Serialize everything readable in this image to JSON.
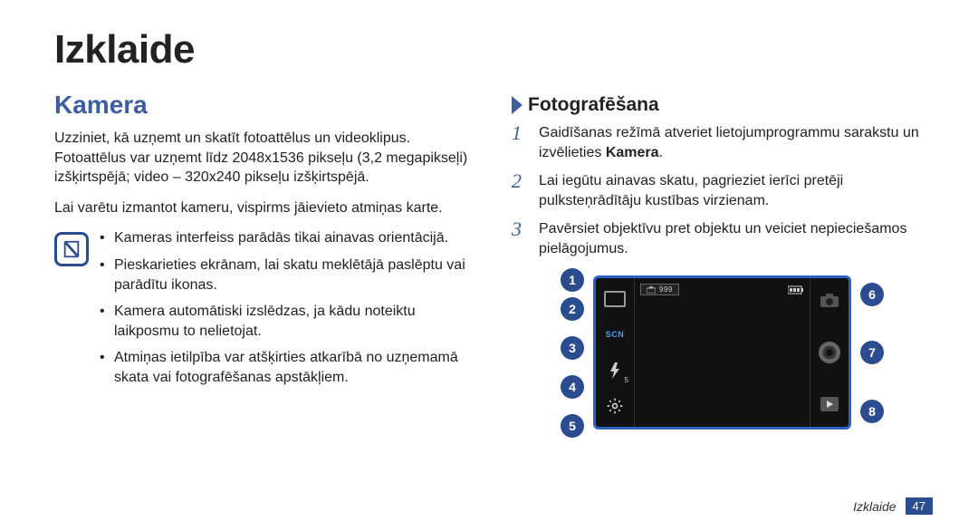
{
  "page_title": "Izklaide",
  "section_title": "Kamera",
  "intro": "Uzziniet, kā uzņemt un skatīt fotoattēlus un videoklipus. Fotoattēlus var uzņemt līdz 2048x1536 pikseļu (3,2 megapikseļi) izšķirtspējā; video – 320x240 pikseļu izšķirtspējā.",
  "intro2": "Lai varētu izmantot kameru, vispirms jāievieto atmiņas karte.",
  "info_bullets": [
    "Kameras interfeiss parādās tikai ainavas orientācijā.",
    "Pieskarieties ekrānam, lai skatu meklētājā paslēptu vai parādītu ikonas.",
    "Kamera automātiski izslēdzas, ja kādu noteiktu laikposmu to nelietojat.",
    "Atmiņas ietilpība var atšķirties atkarībā no uzņemamā skata vai fotografēšanas apstākļiem."
  ],
  "sub_heading": "Fotografēšana",
  "steps": [
    {
      "num": "1",
      "text": "Gaidīšanas režīmā atveriet lietojumprogrammu sarakstu un izvēlieties ",
      "bold": "Kamera",
      "after": "."
    },
    {
      "num": "2",
      "text": "Lai iegūtu ainavas skatu, pagrieziet ierīci pretēji pulksteņrādītāju kustības virzienam.",
      "bold": "",
      "after": ""
    },
    {
      "num": "3",
      "text": "Pavērsiet objektīvu pret objektu un veiciet nepieciešamos pielāgojumus.",
      "bold": "",
      "after": ""
    }
  ],
  "labels_left": [
    "1",
    "2",
    "3",
    "4",
    "5"
  ],
  "labels_right": [
    "6",
    "7",
    "8"
  ],
  "camera": {
    "top_indicator_text": "999",
    "scn_label": "SCN",
    "flash_num": "5"
  },
  "footer_text": "Izklaide",
  "page_number": "47"
}
